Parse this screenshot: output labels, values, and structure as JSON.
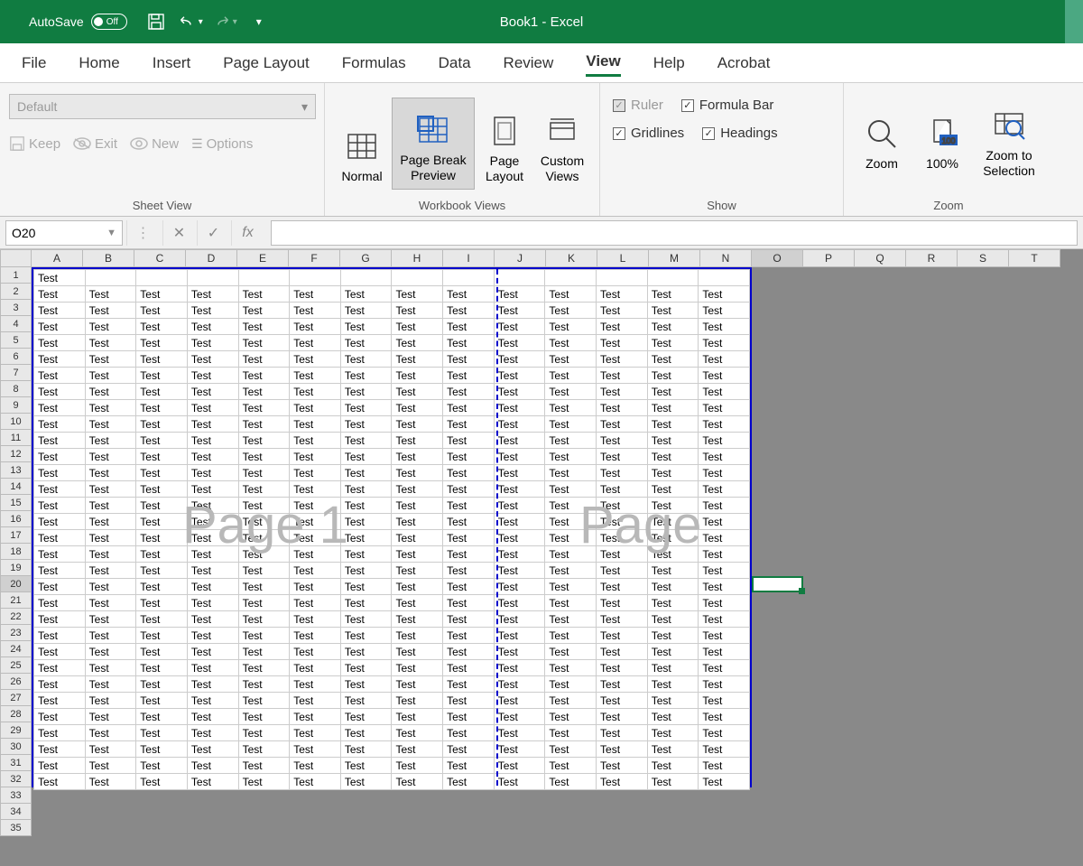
{
  "titleBar": {
    "autosave_label": "AutoSave",
    "autosave_state": "Off",
    "title": "Book1  -  Excel"
  },
  "ribbonTabs": [
    "File",
    "Home",
    "Insert",
    "Page Layout",
    "Formulas",
    "Data",
    "Review",
    "View",
    "Help",
    "Acrobat"
  ],
  "activeTab": "View",
  "sheetView": {
    "dropdown": "Default",
    "keep": "Keep",
    "exit": "Exit",
    "new": "New",
    "options": "Options",
    "group_label": "Sheet View"
  },
  "workbookViews": {
    "normal": "Normal",
    "page_break": "Page Break Preview",
    "page_layout": "Page Layout",
    "custom": "Custom Views",
    "group_label": "Workbook Views"
  },
  "show": {
    "ruler": "Ruler",
    "formula_bar": "Formula Bar",
    "gridlines": "Gridlines",
    "headings": "Headings",
    "group_label": "Show"
  },
  "zoom": {
    "zoom": "Zoom",
    "hundred": "100%",
    "to_selection": "Zoom to Selection",
    "group_label": "Zoom"
  },
  "formulaBar": {
    "name_box": "O20",
    "fx_label": "fx"
  },
  "columns": [
    "A",
    "B",
    "C",
    "D",
    "E",
    "F",
    "G",
    "H",
    "I",
    "J",
    "K",
    "L",
    "M",
    "N",
    "O",
    "P",
    "Q",
    "R",
    "S",
    "T"
  ],
  "data_cols": 14,
  "data_rows": 32,
  "extra_rows": 3,
  "cell_value": "Test",
  "watermark1": "Page 1",
  "watermark2": "Page",
  "selected_cell": "O20",
  "selected_col_index": 14,
  "selected_row_index": 19
}
